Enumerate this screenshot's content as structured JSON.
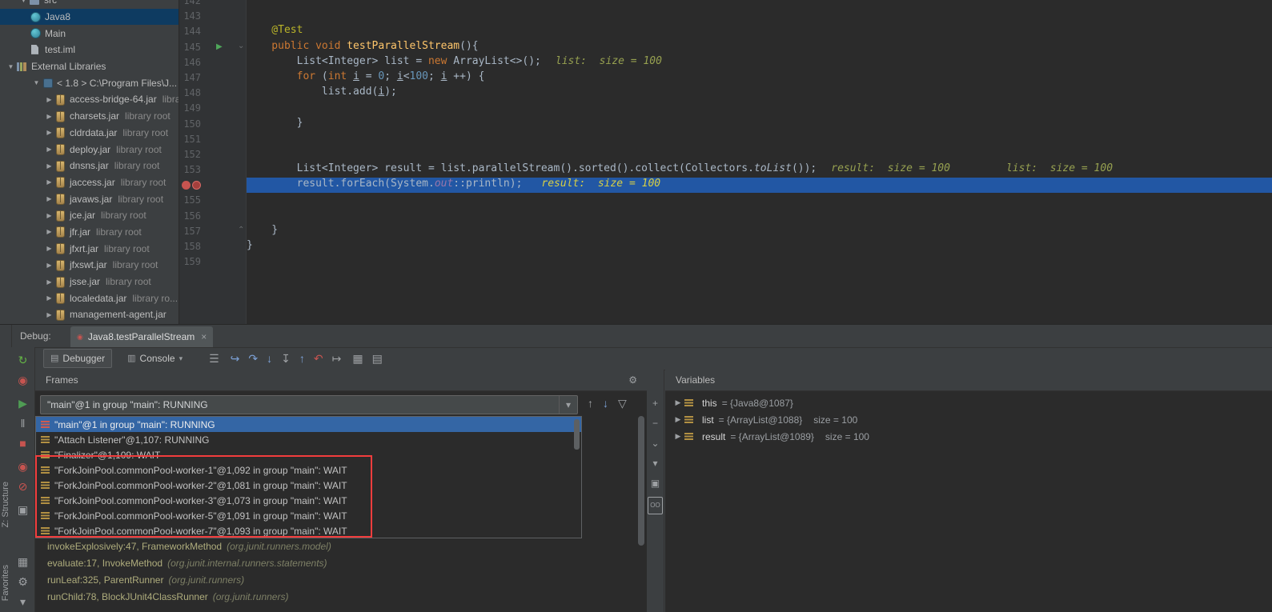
{
  "colors": {
    "tree_selection": "#0e3b61",
    "thread_selection": "#3466a5",
    "execution_line": "#2257a4",
    "annotation_box": "#f23d3d",
    "inline_hint": "#96a050",
    "inline_hint_active": "#d8cf45"
  },
  "stripe": {
    "structure": "Z: Structure",
    "favorites": "Favorites"
  },
  "project_tree": {
    "items": [
      {
        "label": "src",
        "icon": "folder",
        "level": 1,
        "arrow": true,
        "expanded": true
      },
      {
        "label": "Java8",
        "icon": "class",
        "level": 2,
        "selected": true
      },
      {
        "label": "Main",
        "icon": "class",
        "level": 2
      },
      {
        "label": "test.iml",
        "icon": "file",
        "level": 2
      },
      {
        "label": "External Libraries",
        "icon": "libs",
        "level": 0,
        "arrow": true,
        "expanded": true
      },
      {
        "label": "< 1.8 > C:\\Program Files\\J...",
        "icon": "jdk",
        "level": 2,
        "arrow": true,
        "expanded": true
      },
      {
        "label": "access-bridge-64.jar",
        "suffix": "library root",
        "icon": "jar",
        "level": 3,
        "arrow": true
      },
      {
        "label": "charsets.jar",
        "suffix": "library root",
        "icon": "jar",
        "level": 3,
        "arrow": true
      },
      {
        "label": "cldrdata.jar",
        "suffix": "library root",
        "icon": "jar",
        "level": 3,
        "arrow": true
      },
      {
        "label": "deploy.jar",
        "suffix": "library root",
        "icon": "jar",
        "level": 3,
        "arrow": true
      },
      {
        "label": "dnsns.jar",
        "suffix": "library root",
        "icon": "jar",
        "level": 3,
        "arrow": true
      },
      {
        "label": "jaccess.jar",
        "suffix": "library root",
        "icon": "jar",
        "level": 3,
        "arrow": true
      },
      {
        "label": "javaws.jar",
        "suffix": "library root",
        "icon": "jar",
        "level": 3,
        "arrow": true
      },
      {
        "label": "jce.jar",
        "suffix": "library root",
        "icon": "jar",
        "level": 3,
        "arrow": true
      },
      {
        "label": "jfr.jar",
        "suffix": "library root",
        "icon": "jar",
        "level": 3,
        "arrow": true
      },
      {
        "label": "jfxrt.jar",
        "suffix": "library root",
        "icon": "jar",
        "level": 3,
        "arrow": true
      },
      {
        "label": "jfxswt.jar",
        "suffix": "library root",
        "icon": "jar",
        "level": 3,
        "arrow": true
      },
      {
        "label": "jsse.jar",
        "suffix": "library root",
        "icon": "jar",
        "level": 3,
        "arrow": true
      },
      {
        "label": "localedata.jar",
        "suffix": "library ro...",
        "icon": "jar",
        "level": 3,
        "arrow": true
      },
      {
        "label": "management-agent.jar",
        "suffix": "",
        "icon": "jar",
        "level": 3,
        "arrow": true
      }
    ]
  },
  "editor": {
    "lines": [
      {
        "no": 142,
        "segs": []
      },
      {
        "no": 143,
        "segs": []
      },
      {
        "no": 144,
        "segs": [
          [
            "ann",
            "    @Test"
          ]
        ]
      },
      {
        "no": 145,
        "run": true,
        "fold": "⌄",
        "segs": [
          [
            "kw",
            "    public void "
          ],
          [
            "meth",
            "testParallelStream"
          ],
          [
            "pl",
            "(){"
          ]
        ]
      },
      {
        "no": 146,
        "segs": [
          [
            "pl",
            "        List<Integer> list = "
          ],
          [
            "kw",
            "new"
          ],
          [
            "pl",
            " ArrayList<>();"
          ]
        ],
        "hints": [
          "list:  size = 100"
        ]
      },
      {
        "no": 147,
        "segs": [
          [
            "kw",
            "        for"
          ],
          [
            "pl",
            " ("
          ],
          [
            "kw",
            "int"
          ],
          [
            "pl",
            " "
          ],
          [
            "ul",
            "i"
          ],
          [
            "pl",
            " = "
          ],
          [
            "num",
            "0"
          ],
          [
            "pl",
            "; "
          ],
          [
            "ul",
            "i"
          ],
          [
            "pl",
            "<"
          ],
          [
            "num",
            "100"
          ],
          [
            "pl",
            "; "
          ],
          [
            "ul",
            "i"
          ],
          [
            "pl",
            " ++) {"
          ]
        ]
      },
      {
        "no": 148,
        "segs": [
          [
            "pl",
            "            list.add("
          ],
          [
            "ul",
            "i"
          ],
          [
            "pl",
            ");"
          ]
        ]
      },
      {
        "no": 149,
        "segs": []
      },
      {
        "no": 150,
        "segs": [
          [
            "pl",
            "        }"
          ]
        ]
      },
      {
        "no": 151,
        "segs": []
      },
      {
        "no": 152,
        "segs": []
      },
      {
        "no": 153,
        "segs": [
          [
            "pl",
            "        List<Integer> result = list.parallelStream().sorted().collect(Collectors."
          ],
          [
            "ital",
            "toList"
          ],
          [
            "pl",
            "());"
          ]
        ],
        "hints": [
          "result:  size = 100",
          "list:  size = 100"
        ]
      },
      {
        "no": 154,
        "bp": true,
        "current": true,
        "segs": [
          [
            "pl",
            "        result.forEach(System."
          ],
          [
            "field",
            "out"
          ],
          [
            "pl",
            "::println);"
          ]
        ],
        "hints": [
          "result:  size = 100"
        ]
      },
      {
        "no": 155,
        "segs": []
      },
      {
        "no": 156,
        "segs": []
      },
      {
        "no": 157,
        "fold": "⌃",
        "segs": [
          [
            "pl",
            "    }"
          ]
        ]
      },
      {
        "no": 158,
        "segs": [
          [
            "pl",
            "}"
          ]
        ]
      },
      {
        "no": 159,
        "segs": []
      }
    ]
  },
  "debug": {
    "label": "Debug:",
    "tab": {
      "title": "Java8.testParallelStream",
      "close": "×"
    },
    "toolbar": {
      "debugger": "Debugger",
      "console": "Console",
      "console_caret": "▾",
      "icon_groups": [
        [
          {
            "name": "layout-menu-icon",
            "glyph": "☰",
            "color": "#9da0a3"
          }
        ],
        [
          {
            "name": "show-execution-point-icon",
            "glyph": "↪",
            "color": "#7ca1d6"
          },
          {
            "name": "step-over-icon",
            "glyph": "↷",
            "color": "#7ca1d6"
          },
          {
            "name": "step-into-icon",
            "glyph": "↓",
            "color": "#7ca1d6"
          },
          {
            "name": "force-step-into-icon",
            "glyph": "↧",
            "color": "#9da0a3"
          },
          {
            "name": "step-out-icon",
            "glyph": "↑",
            "color": "#7ca1d6"
          },
          {
            "name": "drop-frame-icon",
            "glyph": "↶",
            "color": "#c75450"
          },
          {
            "name": "run-to-cursor-icon",
            "glyph": "↦",
            "color": "#9da0a3"
          }
        ],
        [
          {
            "name": "evaluate-expression-icon",
            "glyph": "▦",
            "color": "#9da0a3"
          },
          {
            "name": "settings-grid-icon",
            "glyph": "▤",
            "color": "#9da0a3"
          }
        ]
      ]
    },
    "left_toolbar": {
      "groups": [
        [
          {
            "name": "rerun-button",
            "glyph": "↻",
            "color": "#64b546"
          },
          {
            "name": "stop-process-button",
            "glyph": "◉",
            "color": "#c75450"
          }
        ],
        [
          {
            "name": "resume-button",
            "glyph": "▶",
            "color": "#4f9c54"
          },
          {
            "name": "pause-button",
            "glyph": "‖",
            "color": "#9da0a3"
          },
          {
            "name": "stop-button",
            "glyph": "■",
            "color": "#c75450"
          }
        ],
        [
          {
            "name": "view-breakpoints-button",
            "glyph": "◉",
            "color": "#c75450"
          },
          {
            "name": "mute-breakpoints-button",
            "glyph": "⊘",
            "color": "#c75450"
          }
        ],
        [
          {
            "name": "thread-dump-button",
            "glyph": "▣",
            "color": "#9da0a3"
          }
        ]
      ],
      "bottom": [
        {
          "name": "restore-layout-button",
          "glyph": "▦",
          "color": "#9da0a3"
        },
        {
          "name": "settings-button",
          "glyph": "⚙",
          "color": "#9da0a3"
        },
        {
          "name": "pin-button",
          "glyph": "▾",
          "color": "#9da0a3"
        }
      ]
    },
    "frames": {
      "title": "Frames",
      "dropdown_value": "\"main\"@1 in group \"main\": RUNNING",
      "dropdown_caret": "▾",
      "nav_icons": [
        {
          "name": "prev-frame-icon",
          "glyph": "↑",
          "color": "#9da0a3"
        },
        {
          "name": "next-frame-icon",
          "glyph": "↓",
          "color": "#7ca1d6"
        },
        {
          "name": "filter-threads-icon",
          "glyph": "▽",
          "color": "#9da0a3"
        }
      ],
      "threads": [
        {
          "label": "\"main\"@1 in group \"main\": RUNNING",
          "selected": true,
          "icon_color": "#cf5b51"
        },
        {
          "label": "\"Attach Listener\"@1,107: RUNNING",
          "icon_color": "#b29043"
        },
        {
          "label": "\"Finalizer\"@1,109: WAIT",
          "icon_color": "#b29043"
        },
        {
          "label": "\"ForkJoinPool.commonPool-worker-1\"@1,092 in group \"main\": WAIT",
          "icon_color": "#b29043"
        },
        {
          "label": "\"ForkJoinPool.commonPool-worker-2\"@1,081 in group \"main\": WAIT",
          "icon_color": "#b29043"
        },
        {
          "label": "\"ForkJoinPool.commonPool-worker-3\"@1,073 in group \"main\": WAIT",
          "icon_color": "#b29043"
        },
        {
          "label": "\"ForkJoinPool.commonPool-worker-5\"@1,091 in group \"main\": WAIT",
          "icon_color": "#b29043"
        },
        {
          "label": "\"ForkJoinPool.commonPool-worker-7\"@1,093 in group \"main\": WAIT",
          "icon_color": "#b29043"
        }
      ],
      "stack": [
        {
          "text": "invokeExplosively:47, FrameworkMethod",
          "pkg": "(org.junit.runners.model)"
        },
        {
          "text": "evaluate:17, InvokeMethod",
          "pkg": "(org.junit.internal.runners.statements)"
        },
        {
          "text": "runLeaf:325, ParentRunner",
          "pkg": "(org.junit.runners)"
        },
        {
          "text": "runChild:78, BlockJUnit4ClassRunner",
          "pkg": "(org.junit.runners)"
        }
      ]
    },
    "mini_icons": [
      {
        "name": "add-icon",
        "glyph": "+"
      },
      {
        "name": "remove-icon",
        "glyph": "−"
      },
      {
        "name": "expand-icon",
        "glyph": "⌄"
      },
      {
        "name": "collapse-icon",
        "glyph": "▾"
      },
      {
        "name": "copy-stack-icon",
        "glyph": "▣"
      },
      {
        "name": "watch-return-values-icon",
        "glyph": "OO",
        "boxed": true
      }
    ],
    "variables": {
      "title": "Variables",
      "rows": [
        {
          "name": "this",
          "value": "= {Java8@1087}",
          "size": ""
        },
        {
          "name": "list",
          "value": "= {ArrayList@1088}",
          "size": "size = 100"
        },
        {
          "name": "result",
          "value": "= {ArrayList@1089}",
          "size": "size = 100"
        }
      ]
    }
  }
}
